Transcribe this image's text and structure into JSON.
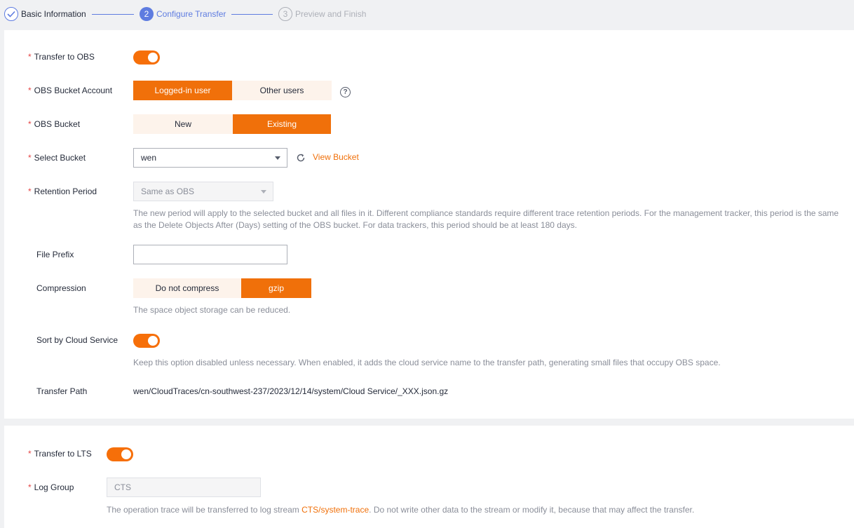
{
  "stepper": {
    "step1": {
      "label": "Basic Information"
    },
    "step2": {
      "number": "2",
      "label": "Configure Transfer"
    },
    "step3": {
      "number": "3",
      "label": "Preview and Finish"
    }
  },
  "obs": {
    "transfer_label": "Transfer to OBS",
    "transfer_enabled": true,
    "account_label": "OBS Bucket Account",
    "account_options": [
      "Logged-in user",
      "Other users"
    ],
    "account_selected": "Logged-in user",
    "bucket_label": "OBS Bucket",
    "bucket_options": [
      "New",
      "Existing"
    ],
    "bucket_selected": "Existing",
    "select_bucket_label": "Select Bucket",
    "select_bucket_value": "wen",
    "view_bucket_link": "View Bucket",
    "retention_label": "Retention Period",
    "retention_value": "Same as OBS",
    "retention_hint_line1": "The new period will apply to the selected bucket and all files in it. Different compliance standards require different trace retention periods. For the management tracker, this period is the same",
    "retention_hint_line2": "as the Delete Objects After (Days) setting of the OBS bucket. For data trackers, this period should be at least 180 days.",
    "file_prefix_label": "File Prefix",
    "file_prefix_value": "",
    "compression_label": "Compression",
    "compression_options": [
      "Do not compress",
      "gzip"
    ],
    "compression_selected": "gzip",
    "compression_hint": "The space object storage can be reduced.",
    "sort_label": "Sort by Cloud Service",
    "sort_enabled": true,
    "sort_hint": "Keep this option disabled unless necessary. When enabled, it adds the cloud service name to the transfer path, generating small files that occupy OBS space.",
    "path_label": "Transfer Path",
    "path_value": "wen/CloudTraces/cn-southwest-237/2023/12/14/system/Cloud Service/_XXX.json.gz"
  },
  "lts": {
    "transfer_label": "Transfer to LTS",
    "transfer_enabled": true,
    "log_group_label": "Log Group",
    "log_group_value": "CTS",
    "hint_before": "The operation trace will be transferred to log stream ",
    "hint_link": "CTS/system-trace",
    "hint_after": ". Do not write other data to the stream or modify it, because that may affect the transfer."
  },
  "colors": {
    "accent": "#f0700a",
    "step_active": "#5e7ce0",
    "required": "#e54545"
  }
}
